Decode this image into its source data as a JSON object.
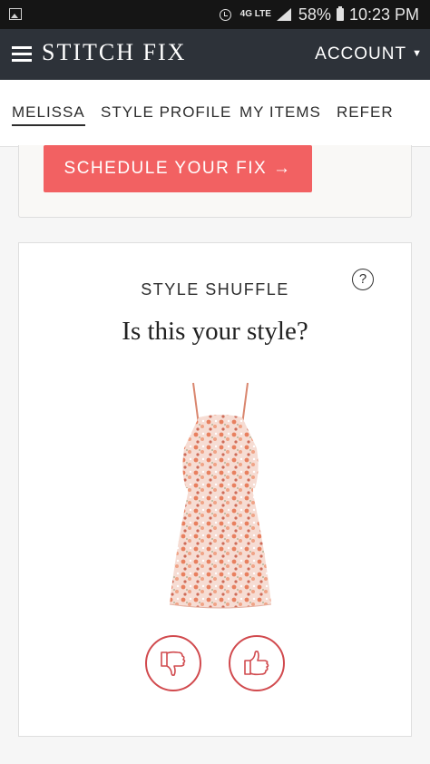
{
  "status_bar": {
    "network": "4G LTE",
    "battery": "58%",
    "time": "10:23 PM"
  },
  "header": {
    "brand": "STITCH FIX",
    "account_label": "ACCOUNT",
    "account_caret": "▼"
  },
  "nav_tabs": [
    {
      "label": "MELISSA",
      "active": true
    },
    {
      "label": "STYLE PROFILE",
      "active": false
    },
    {
      "label": "MY ITEMS",
      "active": false
    },
    {
      "label": "REFER",
      "active": false
    }
  ],
  "promo": {
    "schedule_label": "SCHEDULE YOUR FIX →"
  },
  "style_shuffle": {
    "title": "STYLE SHUFFLE",
    "help_symbol": "?",
    "question": "Is this your style?",
    "item_image": "floral-halter-dress",
    "dislike_icon": "thumbs-down-icon",
    "like_icon": "thumbs-up-icon"
  },
  "colors": {
    "header_bg": "#2d3239",
    "accent": "#f26162",
    "vote_outline": "#d14a4e"
  }
}
